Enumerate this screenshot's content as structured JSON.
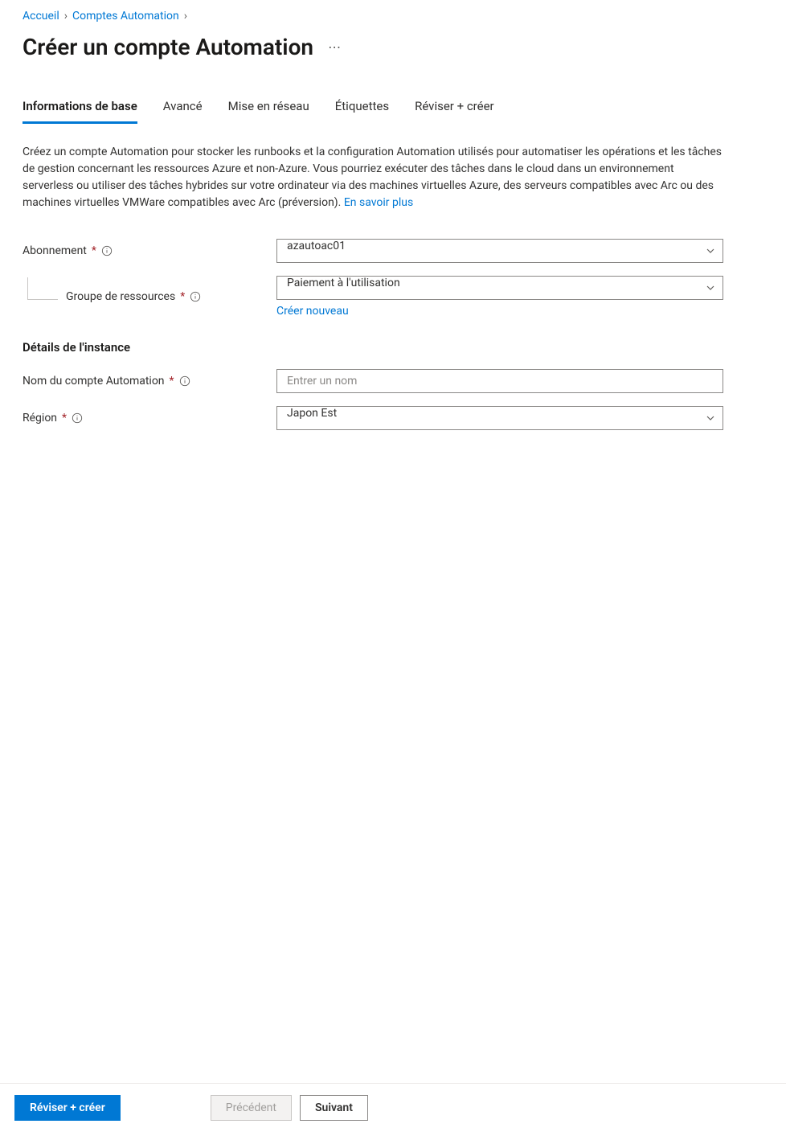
{
  "breadcrumb": {
    "items": [
      {
        "label": "Accueil"
      },
      {
        "label": "Comptes Automation"
      }
    ]
  },
  "page": {
    "title": "Créer un compte Automation"
  },
  "tabs": [
    {
      "label": "Informations de base",
      "active": true
    },
    {
      "label": "Avancé"
    },
    {
      "label": "Mise en réseau"
    },
    {
      "label": "Étiquettes"
    },
    {
      "label": "Réviser + créer"
    }
  ],
  "description": {
    "text": "Créez un compte Automation pour stocker les runbooks et la configuration Automation utilisés pour automatiser les opérations et les tâches de gestion concernant les ressources Azure et non-Azure. Vous pourriez exécuter des tâches dans le cloud dans un environnement serverless ou utiliser des tâches hybrides sur votre ordinateur via des machines virtuelles Azure, des serveurs compatibles avec Arc ou des machines virtuelles VMWare compatibles avec Arc (préversion). ",
    "link_label": "En savoir plus"
  },
  "form": {
    "subscription": {
      "label": "Abonnement",
      "value": "azautoac01"
    },
    "resource_group": {
      "label": "Groupe de ressources",
      "value": "Paiement à l'utilisation",
      "create_new_label": "Créer nouveau"
    },
    "instance_heading": "Détails de l'instance",
    "account_name": {
      "label": "Nom du compte Automation",
      "placeholder": "Entrer un nom",
      "value": ""
    },
    "region": {
      "label": "Région",
      "value": "Japon Est"
    }
  },
  "footer": {
    "review_create": "Réviser + créer",
    "previous": "Précédent",
    "next": "Suivant"
  }
}
